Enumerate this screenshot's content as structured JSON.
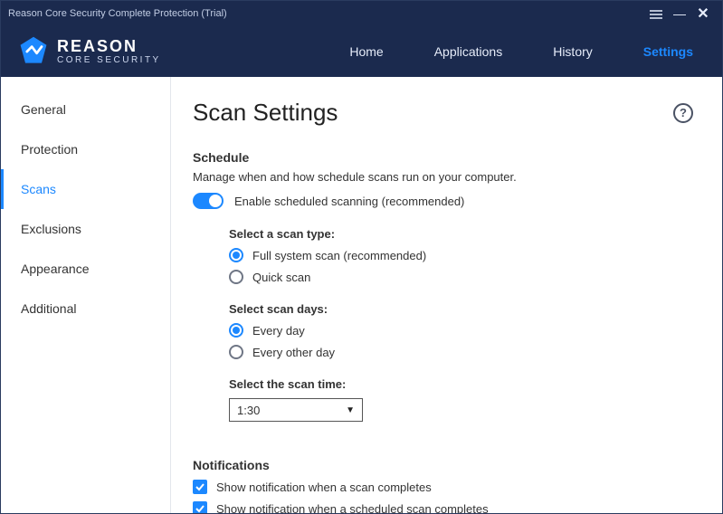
{
  "window": {
    "title": "Reason Core Security Complete Protection (Trial)"
  },
  "brand": {
    "name": "REASON",
    "sub": "CORE SECURITY"
  },
  "nav": {
    "items": [
      {
        "label": "Home"
      },
      {
        "label": "Applications"
      },
      {
        "label": "History"
      },
      {
        "label": "Settings"
      }
    ],
    "active": 3
  },
  "sidebar": {
    "items": [
      {
        "label": "General"
      },
      {
        "label": "Protection"
      },
      {
        "label": "Scans"
      },
      {
        "label": "Exclusions"
      },
      {
        "label": "Appearance"
      },
      {
        "label": "Additional"
      }
    ],
    "active": 2
  },
  "page": {
    "title": "Scan Settings",
    "schedule": {
      "heading": "Schedule",
      "description": "Manage when and how schedule scans run on your computer.",
      "toggle_label": "Enable scheduled scanning (recommended)",
      "toggle_on": true,
      "scan_type_label": "Select a scan type:",
      "scan_type_options": [
        {
          "label": "Full system scan (recommended)",
          "selected": true
        },
        {
          "label": "Quick scan",
          "selected": false
        }
      ],
      "scan_days_label": "Select scan days:",
      "scan_days_options": [
        {
          "label": "Every day",
          "selected": true
        },
        {
          "label": "Every other day",
          "selected": false
        }
      ],
      "scan_time_label": "Select the scan time:",
      "scan_time_value": "1:30"
    },
    "notifications": {
      "heading": "Notifications",
      "items": [
        {
          "label": "Show notification when a scan completes",
          "checked": true
        },
        {
          "label": "Show notification when a scheduled scan completes",
          "checked": true
        }
      ]
    }
  }
}
